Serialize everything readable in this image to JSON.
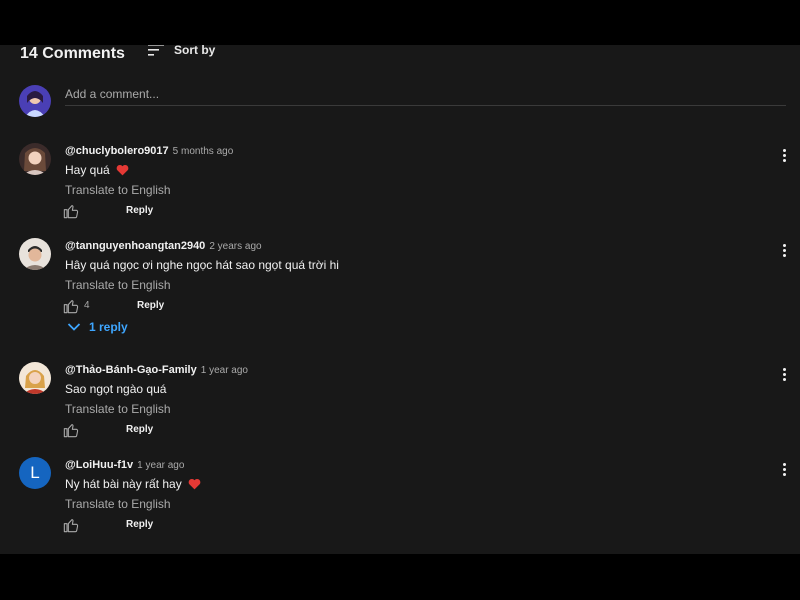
{
  "header": {
    "comment_count": "14 Comments",
    "sort_label": "Sort by"
  },
  "add_comment": {
    "placeholder": "Add a comment..."
  },
  "comments": [
    {
      "author": "@chuclybolero9017",
      "time": "5 months ago",
      "text": "Hay quá",
      "has_heart": true,
      "translate_label": "Translate to English",
      "likes": "",
      "reply_label": "Reply"
    },
    {
      "author": "@tannguyenhoangtan2940",
      "time": "2 years ago",
      "text": "Hây quá ngọc ơi  nghe ngọc hát sao  ngọt quá trời hi",
      "has_heart": false,
      "translate_label": "Translate to English",
      "likes": "4",
      "reply_label": "Reply",
      "replies_label": "1 reply"
    },
    {
      "author": "@Thảo-Bánh-Gạo-Family",
      "time": "1 year ago",
      "text": "Sao ngọt ngào quá",
      "has_heart": false,
      "translate_label": "Translate to English",
      "likes": "",
      "reply_label": "Reply"
    },
    {
      "author": "@LoiHuu-f1v",
      "time": "1 year ago",
      "text": "Ny hát bài này rất hay",
      "has_heart": true,
      "avatar_letter": "L",
      "translate_label": "Translate to English",
      "likes": "",
      "reply_label": "Reply"
    }
  ],
  "icons": {
    "sort": "sort-icon",
    "like": "thumbs-up-icon",
    "more": "more-vert-icon",
    "expand": "chevron-down-icon",
    "heart": "heart-emoji-icon"
  },
  "colors": {
    "background": "#181818",
    "text": "#f1f1f1",
    "secondary_text": "#aaaaaa",
    "link_blue": "#3ea6ff",
    "heart_red": "#e53935",
    "letter_avatar": "#1565c0"
  }
}
